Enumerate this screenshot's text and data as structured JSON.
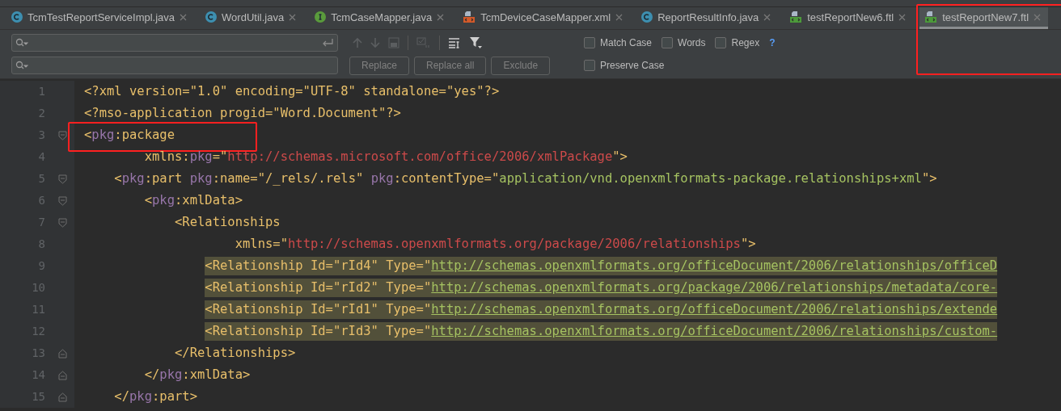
{
  "tabs": [
    {
      "label": "TcmTestReportServiceImpl.java",
      "kind": "class",
      "selected": false,
      "marked": false
    },
    {
      "label": "WordUtil.java",
      "kind": "class",
      "selected": false,
      "marked": false
    },
    {
      "label": "TcmCaseMapper.java",
      "kind": "interface",
      "selected": false,
      "marked": false
    },
    {
      "label": "TcmDeviceCaseMapper.xml",
      "kind": "xml",
      "selected": false,
      "marked": false
    },
    {
      "label": "ReportResultInfo.java",
      "kind": "class",
      "selected": false,
      "marked": false
    },
    {
      "label": "testReportNew6.ftl",
      "kind": "ftl",
      "selected": false,
      "marked": false
    },
    {
      "label": "testReportNew7.ftl",
      "kind": "ftl",
      "selected": true,
      "marked": true
    }
  ],
  "find_bar": {
    "options": [
      {
        "label": "Match Case",
        "checked": false
      },
      {
        "label": "Words",
        "checked": false
      },
      {
        "label": "Regex",
        "checked": false
      }
    ],
    "help": "?",
    "replace_buttons": [
      {
        "label": "Replace",
        "disabled": true
      },
      {
        "label": "Replace all",
        "disabled": true
      },
      {
        "label": "Exclude",
        "disabled": true
      }
    ],
    "replace_options": [
      {
        "label": "Preserve Case",
        "checked": false
      }
    ]
  },
  "editor": {
    "lines": [
      {
        "number": "1",
        "fold_start": false,
        "fold_end": false,
        "highlighted": false,
        "marked": false,
        "tokens": [
          {
            "kind": "plain",
            "text": "<?xml version=\"1.0\" encoding=\"UTF-8\" standalone=\"yes\"?>"
          }
        ]
      },
      {
        "number": "2",
        "fold_start": false,
        "fold_end": false,
        "highlighted": false,
        "marked": false,
        "tokens": [
          {
            "kind": "plain",
            "text": "<?mso-application progid=\"Word.Document\"?>"
          }
        ]
      },
      {
        "number": "3",
        "fold_start": true,
        "fold_end": false,
        "highlighted": false,
        "marked": true,
        "tokens": [
          {
            "kind": "bracket",
            "text": "<"
          },
          {
            "kind": "ns",
            "text": "pkg"
          },
          {
            "kind": "plain",
            "text": ":package"
          }
        ]
      },
      {
        "number": "4",
        "fold_start": false,
        "fold_end": false,
        "highlighted": false,
        "marked": false,
        "tokens": [
          {
            "kind": "plain",
            "text": "        xmlns:"
          },
          {
            "kind": "ns",
            "text": "pkg"
          },
          {
            "kind": "plain",
            "text": "=\""
          },
          {
            "kind": "uri",
            "text": "http://schemas.microsoft.com/office/2006/xmlPackage"
          },
          {
            "kind": "plain",
            "text": "\">"
          }
        ]
      },
      {
        "number": "5",
        "fold_start": true,
        "fold_end": false,
        "highlighted": false,
        "marked": false,
        "tokens": [
          {
            "kind": "bracket",
            "text": "    <"
          },
          {
            "kind": "ns",
            "text": "pkg"
          },
          {
            "kind": "plain",
            "text": ":part "
          },
          {
            "kind": "ns",
            "text": "pkg"
          },
          {
            "kind": "plain",
            "text": ":name=\"/_rels/.rels\" "
          },
          {
            "kind": "ns",
            "text": "pkg"
          },
          {
            "kind": "plain",
            "text": ":contentType=\""
          },
          {
            "kind": "string",
            "text": "application/vnd.openxmlformats-package.relationships+xml"
          },
          {
            "kind": "plain",
            "text": "\">"
          }
        ]
      },
      {
        "number": "6",
        "fold_start": true,
        "fold_end": false,
        "highlighted": false,
        "marked": false,
        "tokens": [
          {
            "kind": "bracket",
            "text": "        <"
          },
          {
            "kind": "ns",
            "text": "pkg"
          },
          {
            "kind": "plain",
            "text": ":xmlData>"
          }
        ]
      },
      {
        "number": "7",
        "fold_start": true,
        "fold_end": false,
        "highlighted": false,
        "marked": false,
        "tokens": [
          {
            "kind": "plain",
            "text": "            <Relationships"
          }
        ]
      },
      {
        "number": "8",
        "fold_start": false,
        "fold_end": false,
        "highlighted": false,
        "marked": false,
        "tokens": [
          {
            "kind": "plain",
            "text": "                    xmlns=\""
          },
          {
            "kind": "uri",
            "text": "http://schemas.openxmlformats.org/package/2006/relationships"
          },
          {
            "kind": "plain",
            "text": "\">"
          }
        ]
      },
      {
        "number": "9",
        "fold_start": false,
        "fold_end": false,
        "highlighted": true,
        "marked": false,
        "tokens": [
          {
            "kind": "plain",
            "text": "                <Relationship Id=\"rId4\" Type=\""
          },
          {
            "kind": "link",
            "text": "http://schemas.openxmlformats.org/officeDocument/2006/relationships/officeD"
          }
        ]
      },
      {
        "number": "10",
        "fold_start": false,
        "fold_end": false,
        "highlighted": true,
        "marked": false,
        "tokens": [
          {
            "kind": "plain",
            "text": "                <Relationship Id=\"rId2\" Type=\""
          },
          {
            "kind": "link",
            "text": "http://schemas.openxmlformats.org/package/2006/relationships/metadata/core-"
          }
        ]
      },
      {
        "number": "11",
        "fold_start": false,
        "fold_end": false,
        "highlighted": true,
        "marked": false,
        "tokens": [
          {
            "kind": "plain",
            "text": "                <Relationship Id=\"rId1\" Type=\""
          },
          {
            "kind": "link",
            "text": "http://schemas.openxmlformats.org/officeDocument/2006/relationships/extende"
          }
        ]
      },
      {
        "number": "12",
        "fold_start": false,
        "fold_end": false,
        "highlighted": true,
        "marked": false,
        "tokens": [
          {
            "kind": "plain",
            "text": "                <Relationship Id=\"rId3\" Type=\""
          },
          {
            "kind": "link",
            "text": "http://schemas.openxmlformats.org/officeDocument/2006/relationships/custom-"
          }
        ]
      },
      {
        "number": "13",
        "fold_start": false,
        "fold_end": true,
        "highlighted": false,
        "marked": false,
        "tokens": [
          {
            "kind": "plain",
            "text": "            </Relationships>"
          }
        ]
      },
      {
        "number": "14",
        "fold_start": false,
        "fold_end": true,
        "highlighted": false,
        "marked": false,
        "tokens": [
          {
            "kind": "bracket",
            "text": "        </"
          },
          {
            "kind": "ns",
            "text": "pkg"
          },
          {
            "kind": "plain",
            "text": ":xmlData>"
          }
        ]
      },
      {
        "number": "15",
        "fold_start": false,
        "fold_end": true,
        "highlighted": false,
        "marked": false,
        "tokens": [
          {
            "kind": "bracket",
            "text": "    </"
          },
          {
            "kind": "ns",
            "text": "pkg"
          },
          {
            "kind": "plain",
            "text": ":part>"
          }
        ]
      }
    ]
  }
}
